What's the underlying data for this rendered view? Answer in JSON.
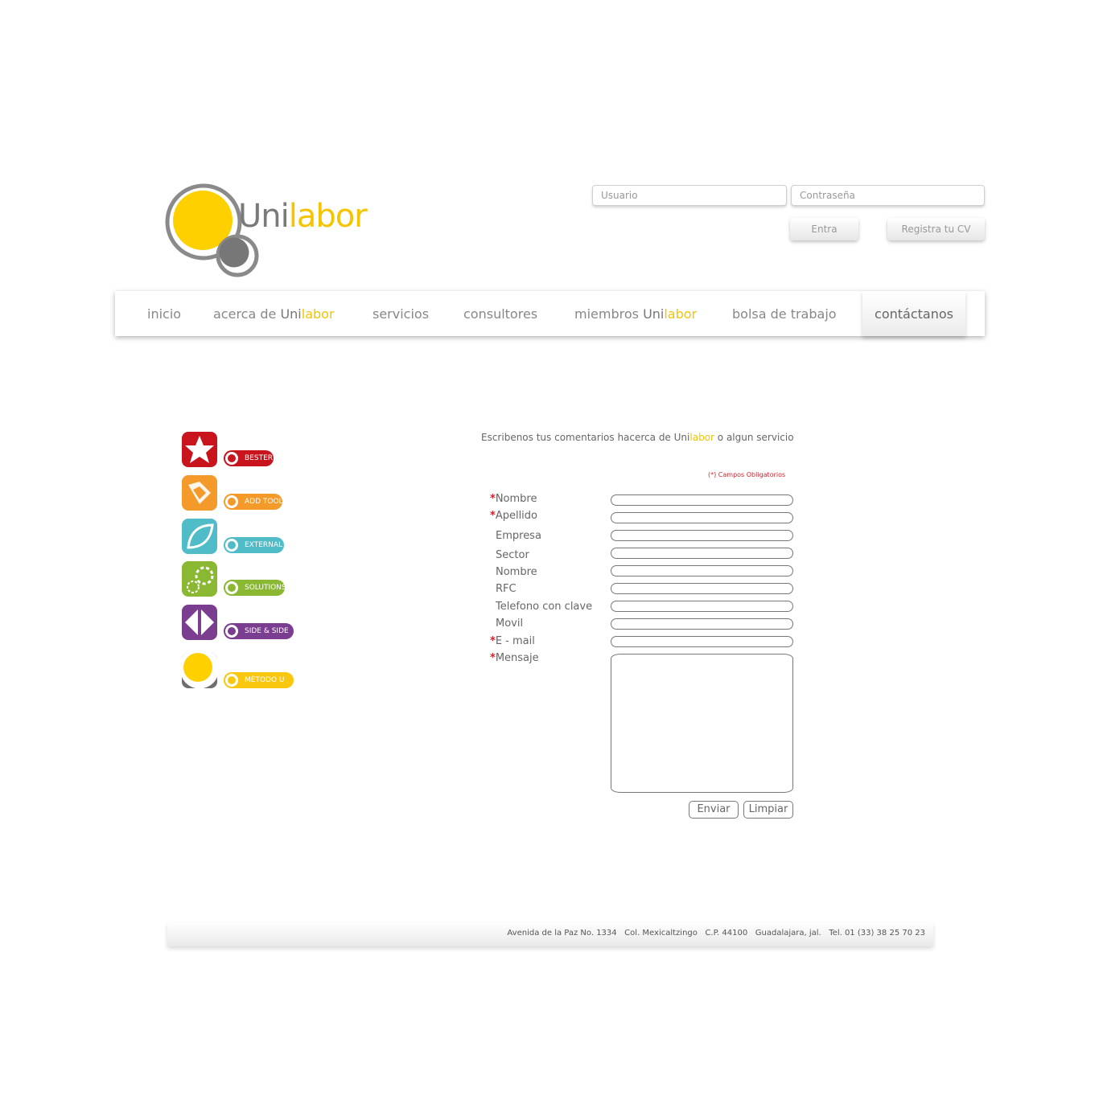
{
  "brand": {
    "name_part1": "Uni",
    "name_part2": "labor",
    "accent": "#f5c400",
    "gray": "#777777"
  },
  "login": {
    "user_placeholder": "Usuario",
    "password_placeholder": "Contraseña",
    "enter_label": "Entra",
    "register_label": "Registra tu CV"
  },
  "nav": {
    "items": [
      {
        "label": "inicio"
      },
      {
        "label": "acerca de ",
        "brand1": "Uni",
        "brand2": "labor"
      },
      {
        "label": "servicios"
      },
      {
        "label": "consultores"
      },
      {
        "label": "miembros ",
        "brand1": "Uni",
        "brand2": "labor"
      },
      {
        "label": "bolsa de trabajo"
      },
      {
        "label": "contáctanos"
      }
    ],
    "active": "contáctanos"
  },
  "sidebar": {
    "items": [
      {
        "label": "BESTER",
        "color": "#c8141d",
        "icon": "star-icon"
      },
      {
        "label": "ADD TOOLS",
        "color": "#f39a2a",
        "icon": "pencil-icon"
      },
      {
        "label": "EXTERNAL",
        "color": "#4fbcc8",
        "icon": "leaf-icon"
      },
      {
        "label": "SOLUTIONS",
        "color": "#8ab833",
        "icon": "gear-icon"
      },
      {
        "label": "SIDE & SIDE",
        "color": "#7b3d90",
        "icon": "arrows-icon"
      },
      {
        "label": "MÉTODO U",
        "color": "#f9c80e",
        "icon": "circle-icon"
      }
    ]
  },
  "form": {
    "intro_before": "Escribenos tus comentarios hacerca de ",
    "intro_brand1": "Uni",
    "intro_brand2": "labor",
    "intro_after": " o algun servicio",
    "required_note": "(*) Campos Obligatorios",
    "fields": [
      {
        "label": "Nombre",
        "required": true
      },
      {
        "label": "Apellido",
        "required": true
      },
      {
        "label": "Empresa",
        "required": false
      },
      {
        "label": "Sector",
        "required": false
      },
      {
        "label": "Nombre",
        "required": false
      },
      {
        "label": "RFC",
        "required": false
      },
      {
        "label": "Telefono con clave",
        "required": false
      },
      {
        "label": "Movil",
        "required": false
      },
      {
        "label": "E - mail",
        "required": true
      },
      {
        "label": "Mensaje",
        "required": true
      }
    ],
    "required_marker": "*",
    "send_label": "Enviar",
    "clear_label": "Limpiar"
  },
  "footer": {
    "address": "Avenida de la Paz No. 1334   Col. Mexicaltzingo   C.P. 44100   Guadalajara, jal.   Tel. 01 (33) 38 25 70 23"
  }
}
